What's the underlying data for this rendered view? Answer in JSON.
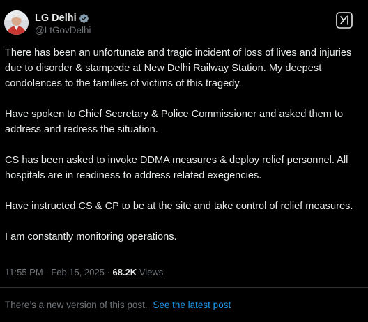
{
  "author": {
    "name": "LG Delhi",
    "handle": "@LtGovDelhi",
    "verified": true,
    "verified_color": "#829aab"
  },
  "tweet": {
    "paragraphs": [
      "There has been an unfortunate and tragic incident of loss of lives and injuries due to disorder & stampede at New Delhi Railway Station. My deepest condolences to the families of victims of this tragedy.",
      "Have spoken to Chief Secretary & Police Commissioner and asked them to address and redress the situation.",
      "CS has been asked to invoke DDMA measures & deploy relief personnel. All hospitals are in readiness to address related exegencies.",
      "Have instructed CS & CP to be at the site and take control of relief measures.",
      "I am constantly monitoring operations."
    ]
  },
  "meta": {
    "time": "11:55 PM",
    "separator": "·",
    "date": "Feb 15, 2025",
    "views_count": "68.2K",
    "views_label": "Views"
  },
  "notice": {
    "text": "There’s a new version of this post.",
    "link": "See the latest post"
  },
  "icons": {
    "grok": "grok-icon",
    "verified": "verified-badge-icon"
  },
  "colors": {
    "background": "#000000",
    "text": "#e7e9ea",
    "muted": "#71767b",
    "link": "#1d9bf0",
    "divider": "#2f3336"
  }
}
